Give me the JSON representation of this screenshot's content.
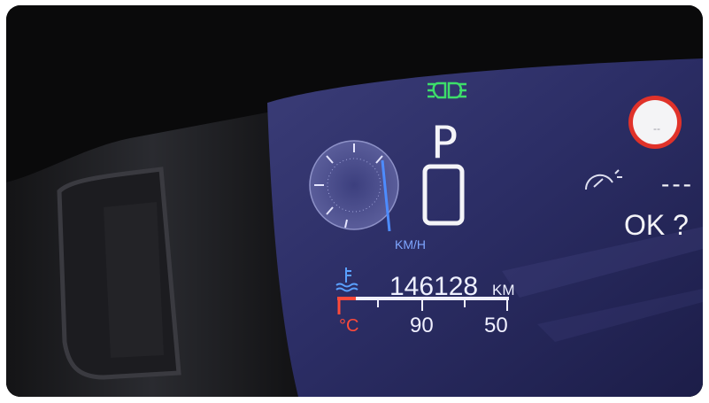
{
  "gear": {
    "selected": "P",
    "indicator_icon": "gear-shift-box-icon"
  },
  "speedometer": {
    "unit": "KM/H",
    "needle_position": "just below the top"
  },
  "odometer": {
    "value": "146128",
    "unit": "KM"
  },
  "coolant": {
    "icon": "coolant-temperature-icon",
    "unit": "°C",
    "scale_mid": "90",
    "scale_high": "50"
  },
  "status": {
    "headlight_icon": "low-beam-headlight-icon",
    "headlight_color": "#3dde6a",
    "warning_icon": "warning-circle-icon",
    "warning_text": "--",
    "warning_color": "#e0322a",
    "service_icon": "service-gauge-icon",
    "service_dashes": "---",
    "ok_prompt": "OK ?"
  }
}
